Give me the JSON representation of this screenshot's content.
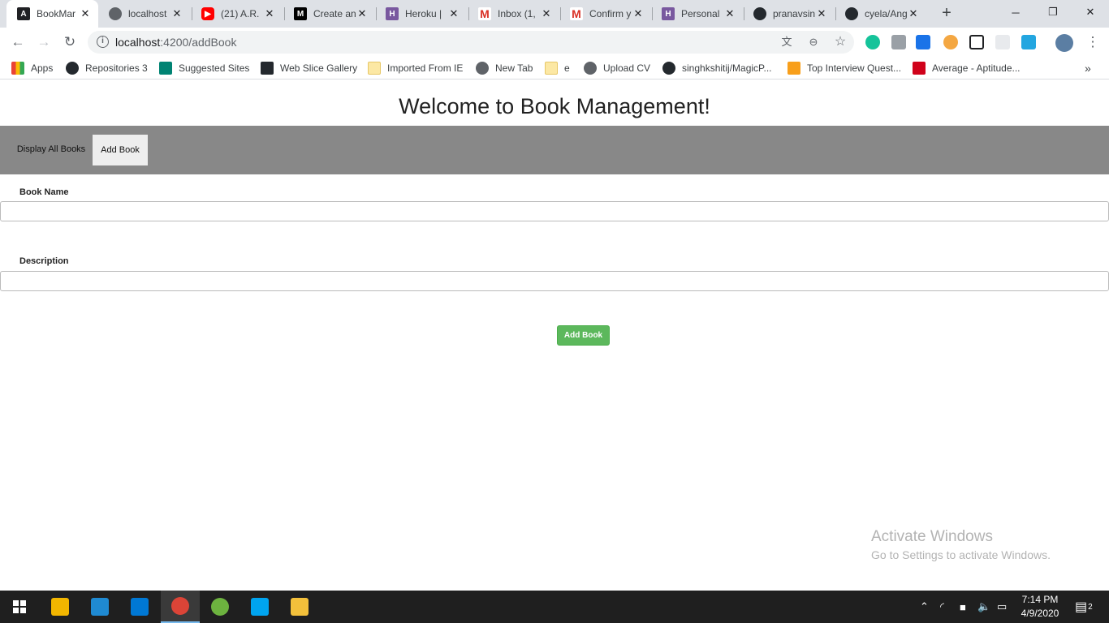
{
  "browser": {
    "tabs": [
      {
        "label": "BookMar",
        "icon": "angular-icon",
        "color": "#202124"
      },
      {
        "label": "localhost",
        "icon": "globe-icon",
        "color": "#5f6368"
      },
      {
        "label": "(21) A.R.",
        "icon": "youtube-icon",
        "color": "#ff0000"
      },
      {
        "label": "Create an",
        "icon": "medium-icon",
        "color": "#000000"
      },
      {
        "label": "Heroku |",
        "icon": "heroku-icon",
        "color": "#79589f"
      },
      {
        "label": "Inbox (1,",
        "icon": "gmail-icon",
        "color": "#d93025"
      },
      {
        "label": "Confirm y",
        "icon": "gmail-icon",
        "color": "#d93025"
      },
      {
        "label": "Personal",
        "icon": "heroku-icon",
        "color": "#79589f"
      },
      {
        "label": "pranavsin",
        "icon": "github-icon",
        "color": "#24292e"
      },
      {
        "label": "cyela/Ang",
        "icon": "github-icon",
        "color": "#24292e"
      }
    ],
    "url_host": "localhost",
    "url_path": ":4200/addBook",
    "bookmarks": [
      {
        "label": "Apps",
        "icon": "apps-grid-icon"
      },
      {
        "label": "Repositories 3",
        "icon": "github-icon"
      },
      {
        "label": "Suggested Sites",
        "icon": "bing-icon"
      },
      {
        "label": "Web Slice Gallery",
        "icon": "web-slice-icon"
      },
      {
        "label": "Imported From IE",
        "icon": "folder-icon"
      },
      {
        "label": "New Tab",
        "icon": "globe-icon"
      },
      {
        "label": "e",
        "icon": "folder-icon"
      },
      {
        "label": "Upload CV",
        "icon": "globe-icon"
      },
      {
        "label": "singhkshitij/MagicP...",
        "icon": "github-icon"
      },
      {
        "label": "Top Interview Quest...",
        "icon": "leetcode-icon"
      },
      {
        "label": "Average - Aptitude...",
        "icon": "indiabix-icon"
      }
    ]
  },
  "app": {
    "title": "Welcome to Book Management!",
    "nav": [
      {
        "label": "Display All Books"
      },
      {
        "label": "Add Book"
      }
    ],
    "form": {
      "book_name_label": "Book Name",
      "book_name_value": "",
      "description_label": "Description",
      "description_value": "",
      "submit_label": "Add Book"
    }
  },
  "watermark": {
    "line1": "Activate Windows",
    "line2": "Go to Settings to activate Windows."
  },
  "taskbar": {
    "time": "7:14 PM",
    "date": "4/9/2020",
    "notification_count": "2"
  },
  "colors": {
    "navbar": "#888888",
    "submit": "#5cb85c"
  }
}
